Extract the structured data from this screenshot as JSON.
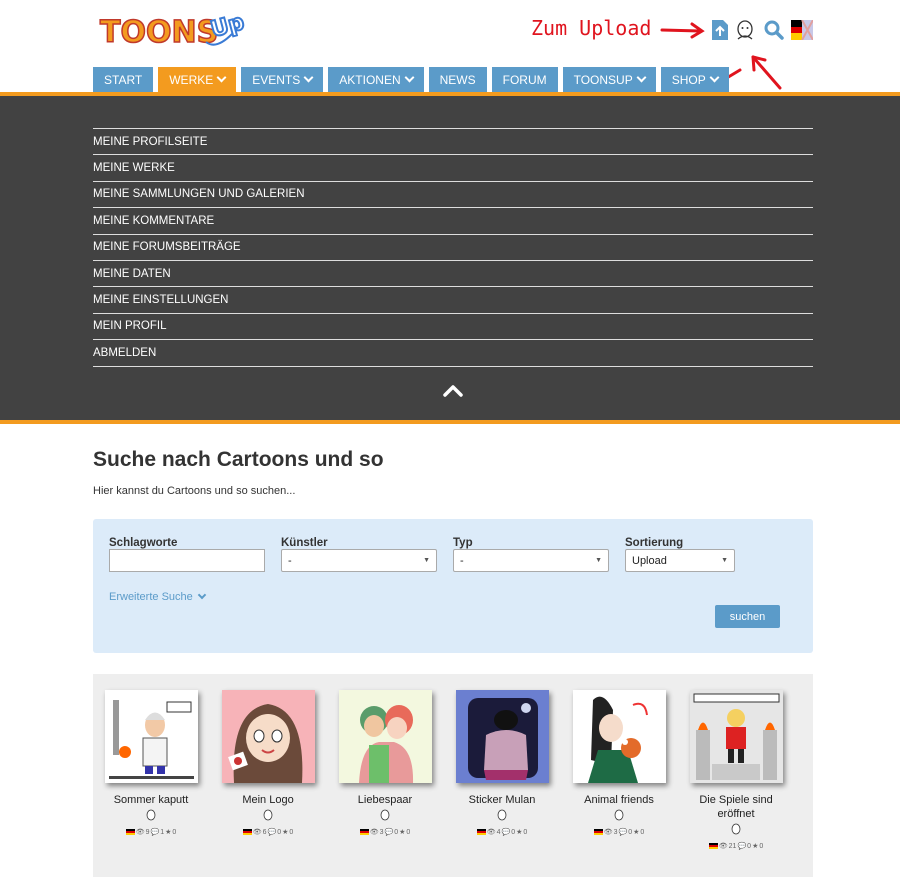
{
  "header": {
    "logo_text": "TOONS UP",
    "annotation": "Zum Upload",
    "icons": [
      "upload-icon",
      "user-avatar-icon",
      "search-icon",
      "language-flag-icon"
    ]
  },
  "nav": [
    {
      "label": "Start",
      "dropdown": false,
      "active": false
    },
    {
      "label": "Werke",
      "dropdown": true,
      "active": true
    },
    {
      "label": "Events",
      "dropdown": true,
      "active": false
    },
    {
      "label": "Aktionen",
      "dropdown": true,
      "active": false
    },
    {
      "label": "News",
      "dropdown": false,
      "active": false
    },
    {
      "label": "Forum",
      "dropdown": false,
      "active": false
    },
    {
      "label": "ToonsUp",
      "dropdown": true,
      "active": false
    },
    {
      "label": "Shop",
      "dropdown": true,
      "active": false
    }
  ],
  "user_menu": [
    "Meine Profilseite",
    "Meine Werke",
    "Meine Sammlungen und Galerien",
    "Meine Kommentare",
    "Meine Forumsbeiträge",
    "Meine Daten",
    "Meine Einstellungen",
    "Mein Profil",
    "Abmelden"
  ],
  "search": {
    "title": "Suche nach Cartoons und so",
    "subtitle": "Hier kannst du Cartoons und so suchen...",
    "keywords_label": "Schlagworte",
    "keywords_value": "",
    "artist_label": "Künstler",
    "artist_value": "-",
    "type_label": "Typ",
    "type_value": "-",
    "sort_label": "Sortierung",
    "sort_value": "Upload",
    "advanced_label": "Erweiterte Suche",
    "submit_label": "suchen"
  },
  "results": [
    {
      "title": "Sommer kaputt",
      "views": "9",
      "comments": "1",
      "favs": "0"
    },
    {
      "title": "Mein Logo",
      "views": "6",
      "comments": "0",
      "favs": "0"
    },
    {
      "title": "Liebespaar",
      "views": "3",
      "comments": "0",
      "favs": "0"
    },
    {
      "title": "Sticker Mulan",
      "views": "4",
      "comments": "0",
      "favs": "0"
    },
    {
      "title": "Animal friends",
      "views": "3",
      "comments": "0",
      "favs": "0"
    },
    {
      "title": "Die Spiele sind eröffnet",
      "views": "21",
      "comments": "0",
      "favs": "0"
    }
  ],
  "colors": {
    "nav_blue": "#5b9bc9",
    "accent_orange": "#f39b1f",
    "dark_panel": "#424242",
    "annotation_red": "#e0141e"
  }
}
